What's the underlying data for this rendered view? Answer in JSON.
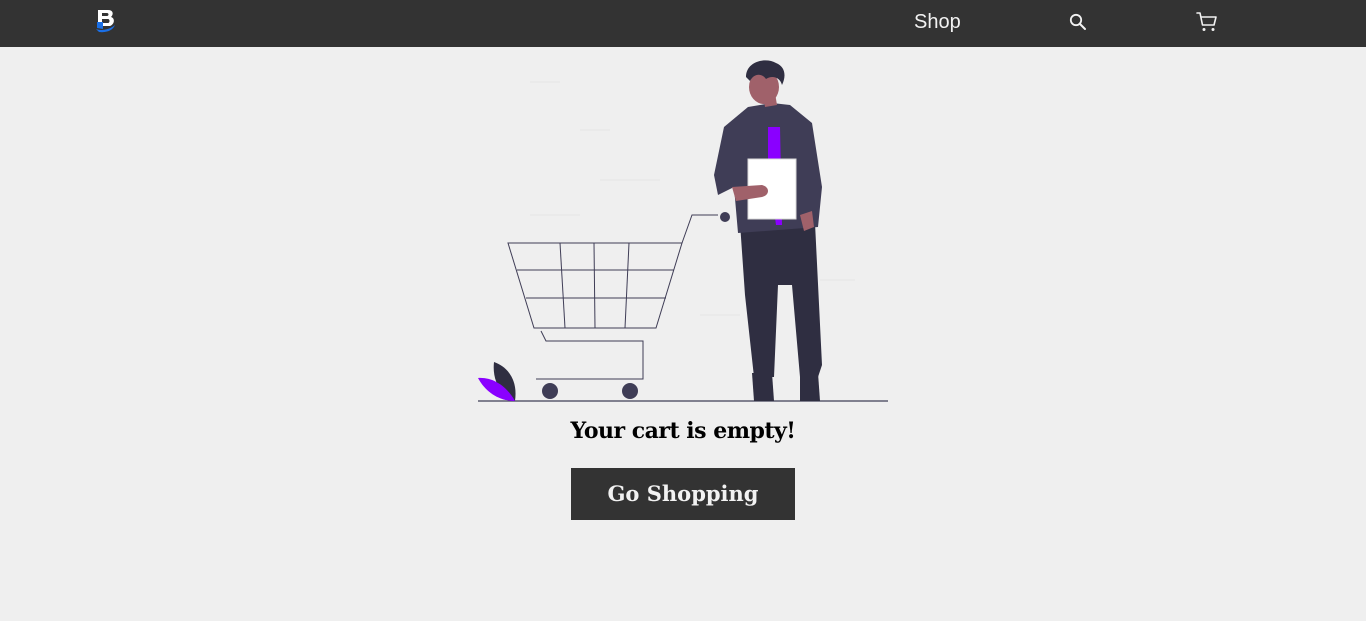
{
  "navbar": {
    "logo_icon": "brand-logo-icon",
    "shop_label": "Shop",
    "search_icon": "search-icon",
    "cart_icon": "cart-icon",
    "background": "#333333"
  },
  "main": {
    "illustration_icon": "empty-cart-illustration",
    "empty_message": "Your cart is empty!",
    "cta_label": "Go Shopping"
  },
  "colors": {
    "page_background": "#efefef",
    "accent_purple": "#8a00ff",
    "dark_purple": "#3f3d56"
  }
}
